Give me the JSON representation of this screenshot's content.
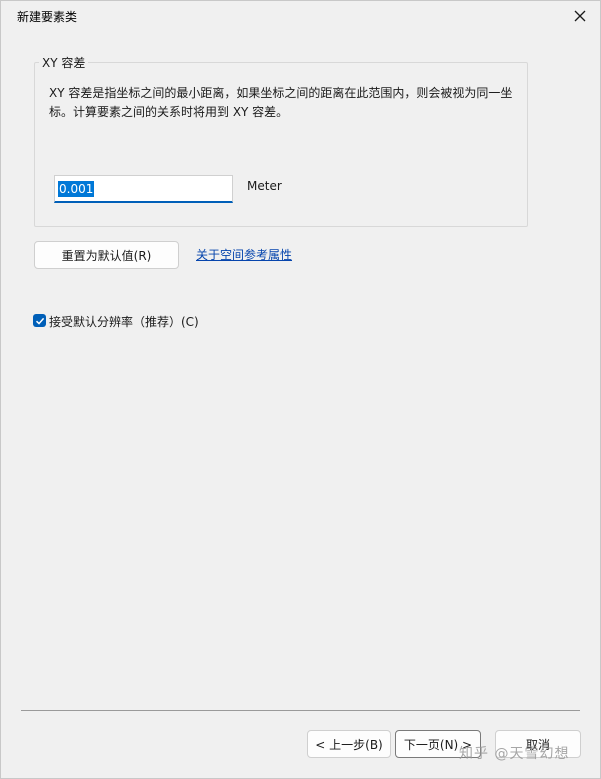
{
  "window": {
    "title": "新建要素类",
    "close_glyph": "✕"
  },
  "xy_tolerance": {
    "group_label": "XY 容差",
    "description": "XY 容差是指坐标之间的最小距离，如果坐标之间的距离在此范围内，则会被视为同一坐标。计算要素之间的关系时将用到 XY 容差。",
    "value": "0.001",
    "unit": "Meter"
  },
  "actions": {
    "reset_label": "重置为默认值(R)",
    "spatial_ref_link": "关于空间参考属性"
  },
  "resolution": {
    "checkbox_label": "接受默认分辨率（推荐）(C)",
    "checked": true
  },
  "footer": {
    "back_label": "< 上一步(B)",
    "next_label": "下一页(N) >",
    "cancel_label": "取消"
  },
  "watermark": "知乎 @天雪幻想",
  "colors": {
    "accent": "#005fb8",
    "link": "#0645ad",
    "background": "#f0f0f0"
  },
  "icons": {
    "close": "close-icon",
    "checkmark": "checkmark-icon"
  }
}
